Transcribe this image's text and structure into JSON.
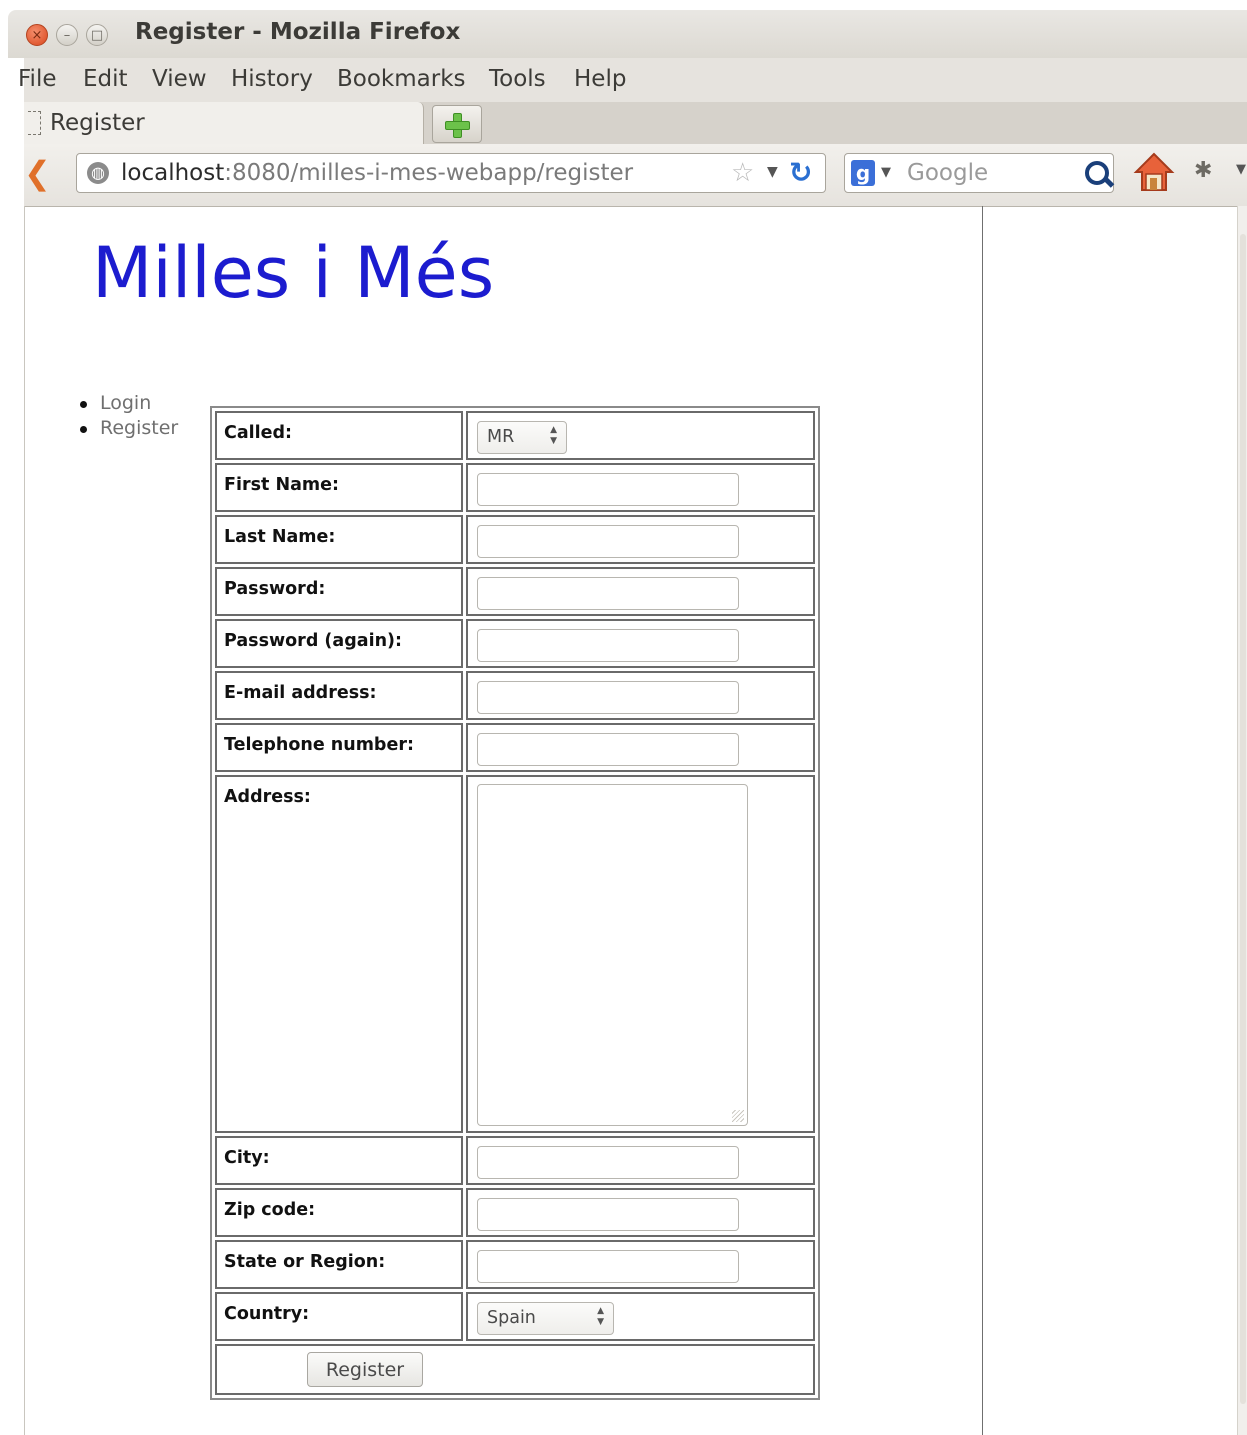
{
  "window": {
    "title": "Register - Mozilla Firefox"
  },
  "menubar": [
    "File",
    "Edit",
    "View",
    "History",
    "Bookmarks",
    "Tools",
    "Help"
  ],
  "tab": {
    "label": "Register"
  },
  "urlbar": {
    "host": "localhost",
    "path": ":8080/milles-i-mes-webapp/register"
  },
  "search": {
    "placeholder": "Google"
  },
  "page": {
    "site_title": "Milles i Més",
    "nav": [
      "Login",
      "Register"
    ],
    "form": {
      "called": {
        "label": "Called:",
        "value": "MR"
      },
      "first_name": {
        "label": "First Name:",
        "value": ""
      },
      "last_name": {
        "label": "Last Name:",
        "value": ""
      },
      "password": {
        "label": "Password:",
        "value": ""
      },
      "password_again": {
        "label": "Password (again):",
        "value": ""
      },
      "email": {
        "label": "E-mail address:",
        "value": ""
      },
      "telephone": {
        "label": "Telephone number:",
        "value": ""
      },
      "address": {
        "label": "Address:",
        "value": ""
      },
      "city": {
        "label": "City:",
        "value": ""
      },
      "zip": {
        "label": "Zip code:",
        "value": ""
      },
      "state": {
        "label": "State or Region:",
        "value": ""
      },
      "country": {
        "label": "Country:",
        "value": "Spain"
      },
      "submit_label": "Register"
    }
  },
  "colors": {
    "site_title": "#1c1ccf",
    "nav_link": "#6f6f6f",
    "chrome": "#e6e3de"
  }
}
